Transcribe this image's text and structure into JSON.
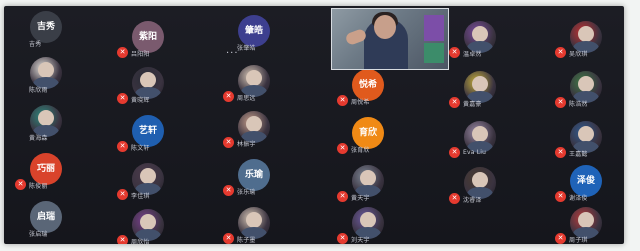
{
  "more_menu_label": "···",
  "video_tile": {
    "label": ""
  },
  "columns": [
    [
      {
        "avatar_text": "吉秀",
        "avatar_color": "#3a3e47",
        "name": "吉秀",
        "mic": false
      },
      {
        "avatar_text": "",
        "avatar_color": "#e6e2dc",
        "name": "陈欣雨",
        "mic": false
      },
      {
        "avatar_text": "",
        "avatar_color": "#2e8a7e",
        "name": "黄海森",
        "mic": false
      },
      {
        "avatar_text": "巧丽",
        "avatar_color": "#d9432b",
        "name": "陈俊丽",
        "mic": true
      },
      {
        "avatar_text": "启瑞",
        "avatar_color": "#5a6677",
        "name": "张启瑞",
        "mic": false
      }
    ],
    [
      {
        "avatar_text": "紫阳",
        "avatar_color": "#7a5a6e",
        "name": "吕阳阳",
        "mic": true
      },
      {
        "avatar_text": "",
        "avatar_color": "#2a2c36",
        "name": "黄晓辉",
        "mic": true,
        "icon": "gift-icon"
      },
      {
        "avatar_text": "艺轩",
        "avatar_color": "#1f5fb0",
        "name": "陈文轩",
        "mic": true
      },
      {
        "avatar_text": "",
        "avatar_color": "#4a3a4a",
        "name": "李佳琪",
        "mic": true
      },
      {
        "avatar_text": "",
        "avatar_color": "#7a3f8e",
        "name": "周欣怡",
        "mic": true
      }
    ],
    [
      {
        "avatar_text": "肇皓",
        "avatar_color": "#3d3f8f",
        "name": "张肇皓",
        "mic": false
      },
      {
        "avatar_text": "",
        "avatar_color": "#d8c7b6",
        "name": "周思远",
        "mic": true
      },
      {
        "avatar_text": "",
        "avatar_color": "#c79f8b",
        "name": "林振宇",
        "mic": true
      },
      {
        "avatar_text": "乐瑜",
        "avatar_color": "#4f6d8e",
        "name": "张乐瑜",
        "mic": true
      },
      {
        "avatar_text": "",
        "avatar_color": "#d8c7b6",
        "name": "陈子墨",
        "mic": true
      }
    ],
    [
      {
        "avatar_text": "",
        "avatar_color": "#1c1d24",
        "name": "",
        "mic": false
      },
      {
        "avatar_text": "悦希",
        "avatar_color": "#e05a1d",
        "name": "周悦希",
        "mic": true
      },
      {
        "avatar_text": "育欣",
        "avatar_color": "#f08a15",
        "name": "张育欣",
        "mic": true
      },
      {
        "avatar_text": "",
        "avatar_color": "#7d8896",
        "name": "黄天宇",
        "mic": true
      },
      {
        "avatar_text": "",
        "avatar_color": "#6c5aa0",
        "name": "刘天宇",
        "mic": true
      }
    ],
    [
      {
        "avatar_text": "",
        "avatar_color": "#7b4c9e",
        "name": "温卓然",
        "mic": true
      },
      {
        "avatar_text": "",
        "avatar_color": "#c9b23a",
        "name": "黄嘉豪",
        "mic": true
      },
      {
        "avatar_text": "",
        "avatar_color": "#9b8aa6",
        "name": "Eva Liu",
        "mic": true
      },
      {
        "avatar_text": "",
        "avatar_color": "#4a3b2f",
        "name": "沈睿泽",
        "mic": true
      }
    ],
    [
      {
        "avatar_text": "",
        "avatar_color": "#c33030",
        "name": "吴欣琪",
        "mic": true
      },
      {
        "avatar_text": "",
        "avatar_color": "#3f7a45",
        "name": "陈浩然",
        "mic": true
      },
      {
        "avatar_text": "",
        "avatar_color": "#2f5a8f",
        "name": "王嘉懿",
        "mic": true
      },
      {
        "avatar_text": "泽俊",
        "avatar_color": "#1f63b8",
        "name": "谢泽俊",
        "mic": true
      },
      {
        "avatar_text": "",
        "avatar_color": "#b83b3b",
        "name": "周子琪",
        "mic": true
      }
    ]
  ]
}
